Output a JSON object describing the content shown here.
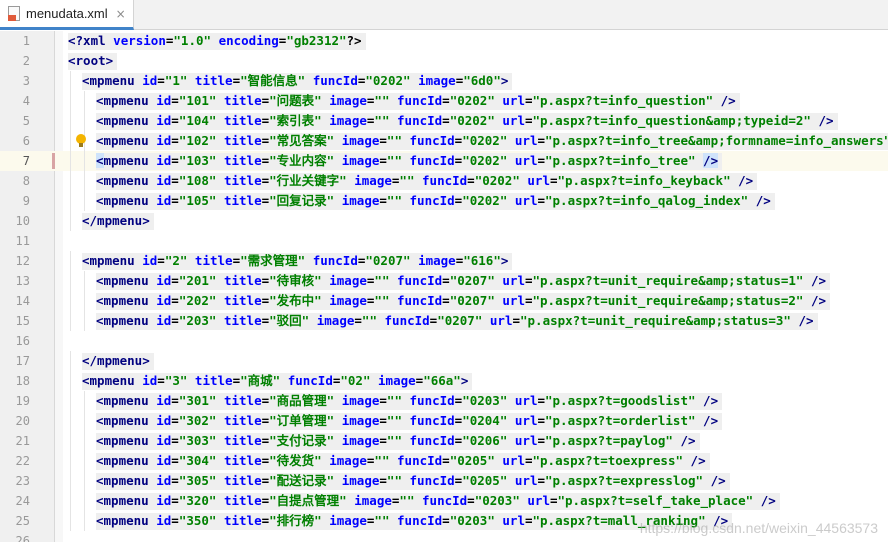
{
  "tab": {
    "filename": "menudata.xml",
    "close_glyph": "×",
    "icon": "xml-file-icon"
  },
  "watermark": "https://blog.csdn.net/weixin_44563573",
  "colors": {
    "tag": "#000080",
    "attribute": "#0000ff",
    "value": "#008000",
    "gutter": "#f0f0f0",
    "tab_accent": "#4083c9"
  },
  "current_line": 7,
  "lines": [
    {
      "n": "1",
      "indent": 0,
      "code": "<?xml version=\"1.0\" encoding=\"gb2312\"?>"
    },
    {
      "n": "2",
      "indent": 0,
      "code": "<root>"
    },
    {
      "n": "3",
      "indent": 1,
      "code": "<mpmenu id=\"1\" title=\"智能信息\" funcId=\"0202\" image=\"6d0\">"
    },
    {
      "n": "4",
      "indent": 2,
      "code": "<mpmenu id=\"101\" title=\"问题表\" image=\"\" funcId=\"0202\" url=\"p.aspx?t=info_question\" />"
    },
    {
      "n": "5",
      "indent": 2,
      "code": "<mpmenu id=\"104\" title=\"索引表\" image=\"\" funcId=\"0202\" url=\"p.aspx?t=info_question&amp;typeid=2\" />"
    },
    {
      "n": "6",
      "indent": 2,
      "code": "<mpmenu id=\"102\" title=\"常见答案\" image=\"\" funcId=\"0202\" url=\"p.aspx?t=info_tree&amp;formname=info_answers\" />"
    },
    {
      "n": "7",
      "indent": 2,
      "code": "<mpmenu id=\"103\" title=\"专业内容\" image=\"\" funcId=\"0202\" url=\"p.aspx?t=info_tree\" />"
    },
    {
      "n": "8",
      "indent": 2,
      "code": "<mpmenu id=\"108\" title=\"行业关键字\" image=\"\" funcId=\"0202\" url=\"p.aspx?t=info_keyback\" />"
    },
    {
      "n": "9",
      "indent": 2,
      "code": "<mpmenu id=\"105\" title=\"回复记录\" image=\"\" funcId=\"0202\" url=\"p.aspx?t=info_qalog_index\" />"
    },
    {
      "n": "10",
      "indent": 1,
      "code": "</mpmenu>"
    },
    {
      "n": "11",
      "indent": 0,
      "code": ""
    },
    {
      "n": "12",
      "indent": 1,
      "code": "<mpmenu id=\"2\" title=\"需求管理\" funcId=\"0207\" image=\"616\">"
    },
    {
      "n": "13",
      "indent": 2,
      "code": "<mpmenu id=\"201\" title=\"待审核\" image=\"\" funcId=\"0207\" url=\"p.aspx?t=unit_require&amp;status=1\" />"
    },
    {
      "n": "14",
      "indent": 2,
      "code": "<mpmenu id=\"202\" title=\"发布中\" image=\"\" funcId=\"0207\" url=\"p.aspx?t=unit_require&amp;status=2\" />"
    },
    {
      "n": "15",
      "indent": 2,
      "code": "<mpmenu id=\"203\" title=\"驳回\" image=\"\" funcId=\"0207\" url=\"p.aspx?t=unit_require&amp;status=3\" />"
    },
    {
      "n": "16",
      "indent": 0,
      "code": ""
    },
    {
      "n": "17",
      "indent": 1,
      "code": "</mpmenu>"
    },
    {
      "n": "18",
      "indent": 1,
      "code": "<mpmenu id=\"3\" title=\"商城\" funcId=\"02\" image=\"66a\">"
    },
    {
      "n": "19",
      "indent": 2,
      "code": "<mpmenu id=\"301\" title=\"商品管理\" image=\"\" funcId=\"0203\" url=\"p.aspx?t=goodslist\" />"
    },
    {
      "n": "20",
      "indent": 2,
      "code": "<mpmenu id=\"302\" title=\"订单管理\" image=\"\" funcId=\"0204\" url=\"p.aspx?t=orderlist\" />"
    },
    {
      "n": "21",
      "indent": 2,
      "code": "<mpmenu id=\"303\" title=\"支付记录\" image=\"\" funcId=\"0206\" url=\"p.aspx?t=paylog\" />"
    },
    {
      "n": "22",
      "indent": 2,
      "code": "<mpmenu id=\"304\" title=\"待发货\" image=\"\" funcId=\"0205\" url=\"p.aspx?t=toexpress\" />"
    },
    {
      "n": "23",
      "indent": 2,
      "code": "<mpmenu id=\"305\" title=\"配送记录\" image=\"\" funcId=\"0205\" url=\"p.aspx?t=expresslog\" />"
    },
    {
      "n": "24",
      "indent": 2,
      "code": "<mpmenu id=\"320\" title=\"自提点管理\" image=\"\" funcId=\"0203\" url=\"p.aspx?t=self_take_place\" />"
    },
    {
      "n": "25",
      "indent": 2,
      "code": "<mpmenu id=\"350\" title=\"排行榜\" image=\"\" funcId=\"0203\" url=\"p.aspx?t=mall_ranking\" />"
    },
    {
      "n": "26",
      "indent": 0,
      "code": ""
    }
  ]
}
